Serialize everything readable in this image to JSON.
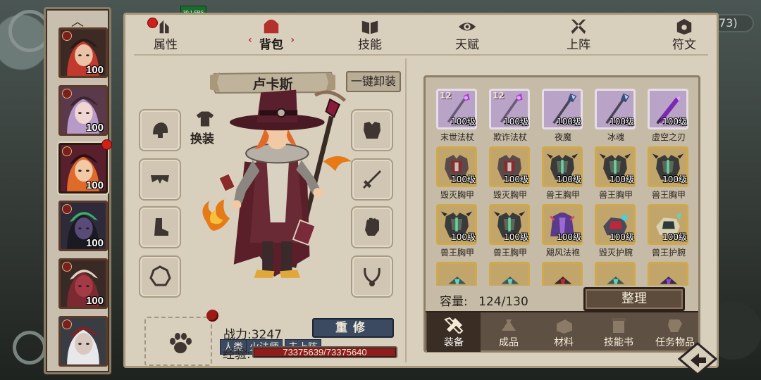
{
  "fps": "30.1 FPS",
  "top_right_count": "73)",
  "tabs": [
    {
      "label": "属性",
      "icon": "stats-icon",
      "active": false,
      "dot": true
    },
    {
      "label": "背包",
      "icon": "backpack-icon",
      "active": true,
      "dot": false
    },
    {
      "label": "技能",
      "icon": "skill-book-icon",
      "active": false,
      "dot": false
    },
    {
      "label": "天赋",
      "icon": "talent-eye-icon",
      "active": false,
      "dot": false
    },
    {
      "label": "上阵",
      "icon": "crossed-swords-icon",
      "active": false,
      "dot": false
    },
    {
      "label": "符文",
      "icon": "rune-icon",
      "active": false,
      "dot": false
    }
  ],
  "heroes": [
    {
      "level": "100",
      "portrait": "hooded-red-hair-hero",
      "dot": false
    },
    {
      "level": "100",
      "portrait": "lilac-hair-hero",
      "dot": false
    },
    {
      "level": "100",
      "portrait": "fire-mage-hero",
      "dot": true,
      "active": true
    },
    {
      "level": "100",
      "portrait": "dark-elf-hero",
      "dot": false
    },
    {
      "level": "100",
      "portrait": "horned-demon-hero",
      "dot": false
    },
    {
      "level": "",
      "portrait": "white-hair-hero",
      "dot": false
    }
  ],
  "character": {
    "name": "卢卡斯",
    "unequip_all": "一键卸装",
    "swap_label": "换装",
    "tags": [
      "人类",
      "火法师",
      "未上阵"
    ],
    "power_label": "战力:3247",
    "rebuild_label": "重修",
    "exp_label": "经验:",
    "exp_text": "73375639/73375640",
    "exp_fraction": 0.99999
  },
  "slots_left": [
    "helmet-slot-icon",
    "belt-slot-icon",
    "boots-slot-icon",
    "ring-slot-icon"
  ],
  "slots_right": [
    "armor-slot-icon",
    "weapon-slot-icon",
    "gauntlet-slot-icon",
    "necklace-slot-icon"
  ],
  "inventory": {
    "items": [
      {
        "name": "末世法杖",
        "level": "100级",
        "star": "12",
        "tier": "purple",
        "art": "staff"
      },
      {
        "name": "欺诈法杖",
        "level": "100级",
        "star": "12",
        "tier": "purple",
        "art": "staff"
      },
      {
        "name": "夜魔",
        "level": "100级",
        "star": "",
        "tier": "purple",
        "art": "spear"
      },
      {
        "name": "冰魂",
        "level": "100级",
        "star": "",
        "tier": "purple",
        "art": "spear"
      },
      {
        "name": "虚空之刃",
        "level": "100级",
        "star": "",
        "tier": "purple",
        "art": "blade"
      },
      {
        "name": "毁灭胸甲",
        "level": "100级",
        "star": "",
        "tier": "gold",
        "art": "armor-red"
      },
      {
        "name": "毁灭胸甲",
        "level": "100级",
        "star": "",
        "tier": "gold",
        "art": "armor-red"
      },
      {
        "name": "兽王胸甲",
        "level": "100级",
        "star": "",
        "tier": "gold",
        "art": "armor-green"
      },
      {
        "name": "兽王胸甲",
        "level": "100级",
        "star": "",
        "tier": "gold",
        "art": "armor-green"
      },
      {
        "name": "兽王胸甲",
        "level": "100级",
        "star": "",
        "tier": "gold",
        "art": "armor-green"
      },
      {
        "name": "兽王胸甲",
        "level": "100级",
        "star": "",
        "tier": "gold",
        "art": "armor-green"
      },
      {
        "name": "兽王胸甲",
        "level": "100级",
        "star": "",
        "tier": "gold",
        "art": "armor-green"
      },
      {
        "name": "飓风法袍",
        "level": "100级",
        "star": "",
        "tier": "gold",
        "art": "robe-purple"
      },
      {
        "name": "毁灭护腕",
        "level": "100级",
        "star": "",
        "tier": "gold",
        "art": "bracer-red"
      },
      {
        "name": "兽王护腕",
        "level": "100级",
        "star": "",
        "tier": "gold",
        "art": "bracer-green"
      },
      {
        "name": "",
        "level": "",
        "star": "",
        "tier": "gold",
        "art": "partial-teal"
      },
      {
        "name": "",
        "level": "",
        "star": "",
        "tier": "gold",
        "art": "partial-teal"
      },
      {
        "name": "",
        "level": "",
        "star": "",
        "tier": "gold",
        "art": "partial-red"
      },
      {
        "name": "",
        "level": "",
        "star": "",
        "tier": "gold",
        "art": "partial-teal"
      },
      {
        "name": "",
        "level": "",
        "star": "",
        "tier": "gold",
        "art": "partial-purple"
      }
    ],
    "capacity_label": "容量:",
    "capacity_value": "124/130",
    "sort_label": "整理",
    "tabs": [
      {
        "label": "装备",
        "icon": "equipment-hammer-icon",
        "active": true
      },
      {
        "label": "成品",
        "icon": "product-bag-icon",
        "active": false
      },
      {
        "label": "材料",
        "icon": "material-block-icon",
        "active": false
      },
      {
        "label": "技能书",
        "icon": "skill-scroll-icon",
        "active": false
      },
      {
        "label": "任务物品",
        "icon": "quest-item-icon",
        "active": false
      }
    ]
  },
  "colors": {
    "panel": "#d8cfbd",
    "accent_red": "#b4302a",
    "button_navy": "#3c4a61",
    "item_gold": "#c3ab6d",
    "item_purple": "#b9a3c6"
  }
}
